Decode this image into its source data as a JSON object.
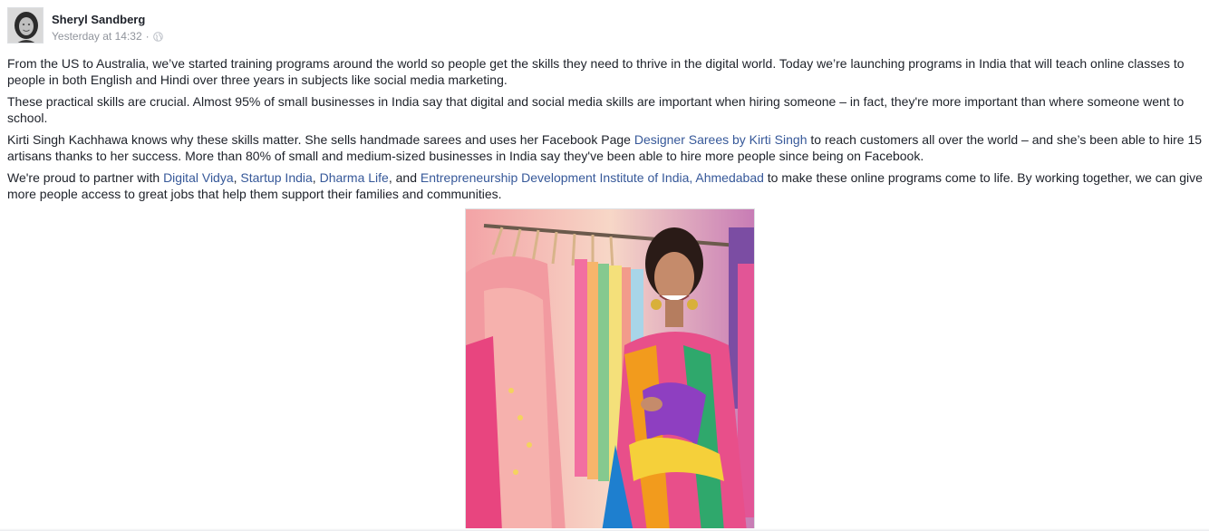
{
  "post": {
    "author": "Sheryl Sandberg",
    "timestamp": "Yesterday at 14:32",
    "separator": "·",
    "privacy_icon": "globe-icon",
    "avatar_icon": "profile-photo",
    "paragraphs": {
      "p1": "From the US to Australia, we’ve started training programs around the world so people get the skills they need to thrive in the digital world. Today we’re launching programs in India that will teach online classes to people in both English and Hindi over three years in subjects like social media marketing.",
      "p2": "These practical skills are crucial. Almost 95% of small businesses in India say that digital and social media skills are important when hiring someone – in fact, they're more important than where someone went to school.",
      "p3": {
        "before": "Kirti Singh Kachhawa knows why these skills matter. She sells handmade sarees and uses her Facebook Page ",
        "link": "Designer Sarees by Kirti Singh",
        "after": " to reach customers all over the world – and she’s been able to hire 15 artisans thanks to her success. More than 80% of small and medium-sized businesses in India say they've been able to hire more people since being on Facebook."
      },
      "p4": {
        "before": "We're proud to partner with ",
        "link1": "Digital Vidya",
        "sep1": ", ",
        "link2": "Startup India",
        "sep2": ", ",
        "link3": "Dharma Life",
        "sep3": ", and ",
        "link4": "Entrepreneurship Development Institute of India, Ahmedabad",
        "after": " to make these online programs come to life. By working together, we can give more people access to great jobs that help them support their families and communities."
      }
    },
    "photo_alt": "photo"
  },
  "colors": {
    "text": "#1d2129",
    "link": "#365899",
    "meta": "#90949c"
  }
}
